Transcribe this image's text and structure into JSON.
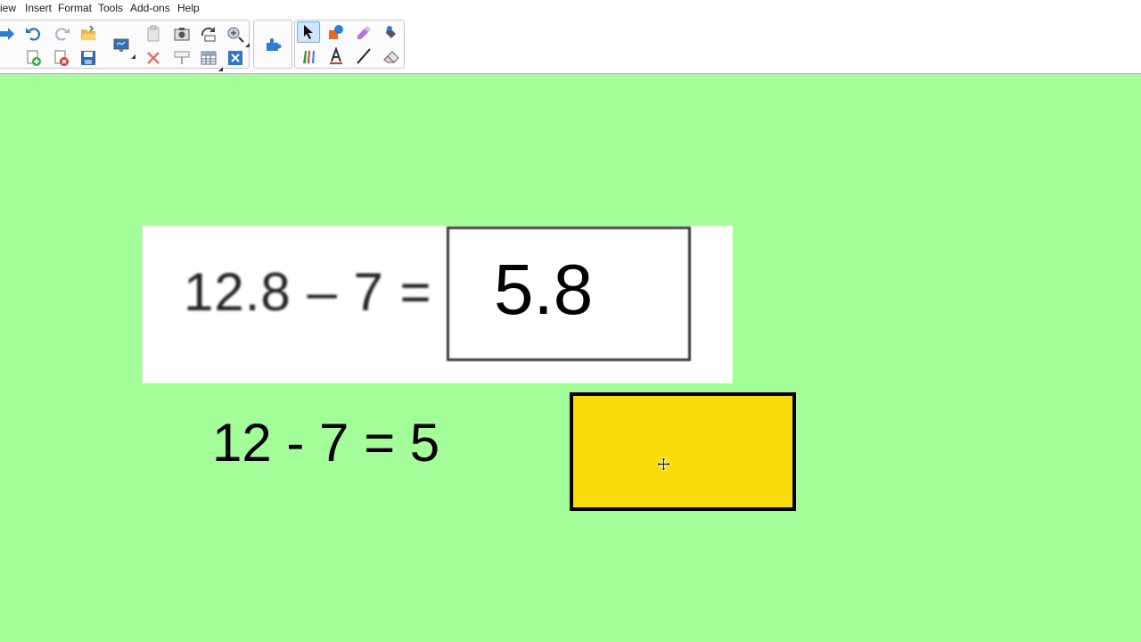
{
  "menu": [
    "iew",
    "Insert",
    "Format",
    "Tools",
    "Add-ons",
    "Help"
  ],
  "toolbar": {
    "icons": [
      "forward-arrow-icon",
      "undo-icon",
      "redo-icon",
      "open-folder-icon",
      "new-page-icon",
      "delete-page-icon",
      "save-icon",
      "screen-display-icon",
      "paste-icon",
      "delete-icon",
      "screen-capture-icon",
      "screen-shade-icon",
      "rotate-icon",
      "table-icon",
      "fill-icon",
      "clear-icon",
      "addons-icon",
      "select-icon",
      "shapes-icon",
      "magic-pen-icon",
      "eraser-tool-icon",
      "pens-icon",
      "text-icon",
      "line-icon",
      "eraser-icon"
    ],
    "active_tool": "select"
  },
  "canvas": {
    "background": "#a3fd99",
    "question_image": {
      "expression": "12.8 – 7 =",
      "answer": "5.8"
    },
    "estimate": "12 - 7 = 5",
    "yellow_box_color": "#f8dd0a"
  }
}
